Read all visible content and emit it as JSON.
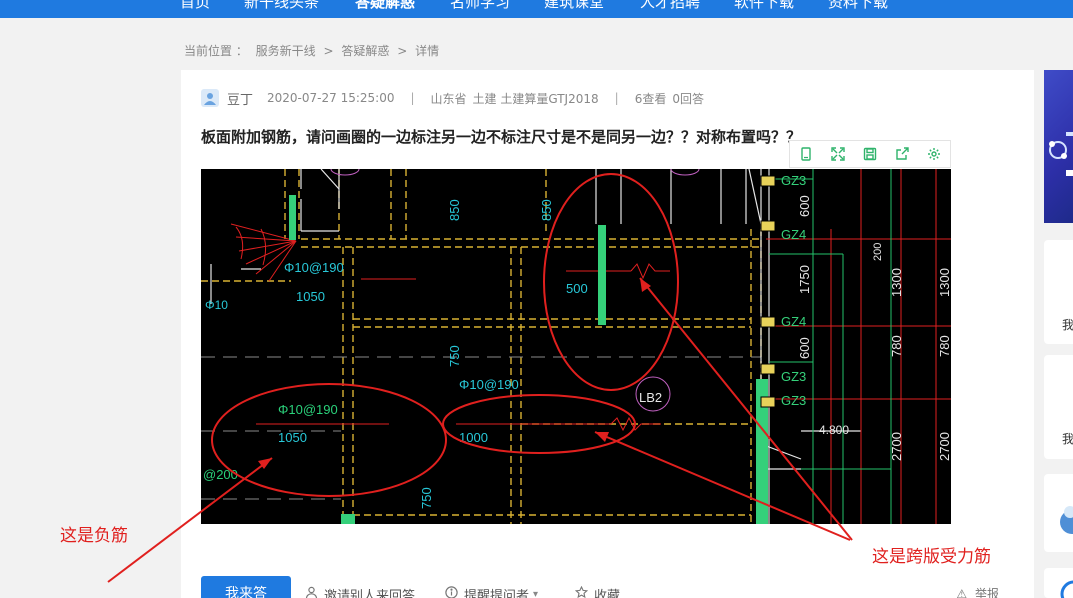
{
  "nav": {
    "items": [
      "首页",
      "新干线头条",
      "答疑解惑",
      "名师学习",
      "建筑课堂",
      "人才招聘",
      "软件下载",
      "资料下载"
    ],
    "active": "答疑解惑"
  },
  "breadcrumb": {
    "prefix": "当前位置 ：",
    "items": [
      "服务新干线",
      "答疑解惑",
      "详情"
    ],
    "separator": ">"
  },
  "question": {
    "author": "豆丁",
    "datetime": "2020-07-27 15:25:00",
    "region": "山东省",
    "category": "土建 土建算量GTJ2018",
    "views": "6查看",
    "answers": "0回答",
    "title": "板面附加钢筋，请问画圈的一边标注另一边不标注尺寸是不是同另一边？？对称布置吗？？"
  },
  "image_toolbar": {
    "icons": [
      "mobile-icon",
      "fullscreen-icon",
      "save-icon",
      "share-icon",
      "settings-icon"
    ],
    "color": "#2fb36b"
  },
  "cad_image": {
    "labels": {
      "rebar1": "Φ10@190",
      "len1": "1050",
      "phi_left": "Φ10",
      "dim850a": "850",
      "dim850b": "850",
      "dim500": "500",
      "dim750a": "750",
      "dim750b": "750",
      "lb2": "LB2",
      "rebar2": "Φ10@190",
      "len2": "1050",
      "dim1000": "1000",
      "at200": "@200",
      "gz3a": "GZ3",
      "gz4a": "GZ4",
      "gz4b": "GZ4",
      "gz3b": "GZ3",
      "gz3c": "GZ3",
      "v600a": "600",
      "v1750": "1750",
      "v600b": "600",
      "v200": "200",
      "v1300a": "1300",
      "v1300b": "1300",
      "v780a": "780",
      "v780b": "780",
      "v2700a": "2700",
      "v2700b": "2700",
      "elev": "4.800"
    }
  },
  "annotations": {
    "negative_rebar": "这是负筋",
    "span_rebar": "这是跨版受力筋",
    "color": "#e0201e"
  },
  "actions": {
    "answer_button": "我来答",
    "invite": "邀请别人来回答",
    "remind": "提醒提问者",
    "favorite": "收藏",
    "report": "举报"
  },
  "sidebar": {
    "card_texts": [
      "我",
      "我"
    ]
  }
}
